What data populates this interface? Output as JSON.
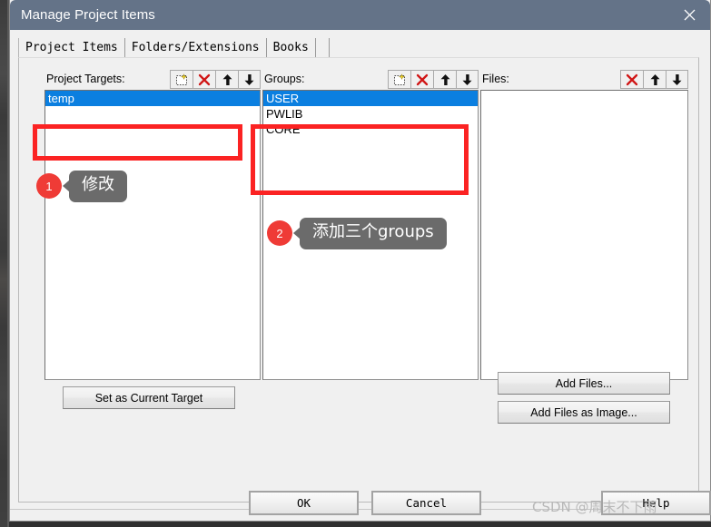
{
  "window": {
    "title": "Manage Project Items",
    "close_icon": "close-icon"
  },
  "tabs": [
    {
      "label": "Project Items",
      "active": true
    },
    {
      "label": "Folders/Extensions",
      "active": false
    },
    {
      "label": "Books",
      "active": false
    }
  ],
  "columns": {
    "project_targets": {
      "label": "Project Targets:",
      "toolbar": [
        {
          "icon": "new-item-icon",
          "name": "new-target-button"
        },
        {
          "icon": "delete-x-icon",
          "name": "delete-target-button"
        },
        {
          "icon": "move-up-arrow-icon",
          "name": "move-target-up-button"
        },
        {
          "icon": "move-down-arrow-icon",
          "name": "move-target-down-button"
        }
      ],
      "items": [
        {
          "text": "temp",
          "selected": true
        }
      ]
    },
    "groups": {
      "label": "Groups:",
      "toolbar": [
        {
          "icon": "new-item-icon",
          "name": "new-group-button"
        },
        {
          "icon": "delete-x-icon",
          "name": "delete-group-button"
        },
        {
          "icon": "move-up-arrow-icon",
          "name": "move-group-up-button"
        },
        {
          "icon": "move-down-arrow-icon",
          "name": "move-group-down-button"
        }
      ],
      "items": [
        {
          "text": "USER",
          "selected": true
        },
        {
          "text": "PWLIB",
          "selected": false
        },
        {
          "text": "CORE",
          "selected": false
        }
      ]
    },
    "files": {
      "label": "Files:",
      "toolbar": [
        {
          "icon": "delete-x-icon",
          "name": "delete-file-button"
        },
        {
          "icon": "move-up-arrow-icon",
          "name": "move-file-up-button"
        },
        {
          "icon": "move-down-arrow-icon",
          "name": "move-file-down-button"
        }
      ],
      "items": []
    }
  },
  "buttons": {
    "set_as_current_target": "Set as Current Target",
    "add_files": "Add Files...",
    "add_files_as_image": "Add Files as Image...",
    "ok": "OK",
    "cancel": "Cancel",
    "help": "Help"
  },
  "annotations": [
    {
      "badge": "1",
      "text": "修改"
    },
    {
      "badge": "2",
      "text": "添加三个groups"
    }
  ],
  "watermark": "CSDN @周末不下雨",
  "colors": {
    "titlebar": "#647388",
    "selection": "#0b7fe0",
    "annotation_red": "#fb2323",
    "badge_red": "#ef3b36",
    "bubble_gray": "#6b6b6b"
  }
}
